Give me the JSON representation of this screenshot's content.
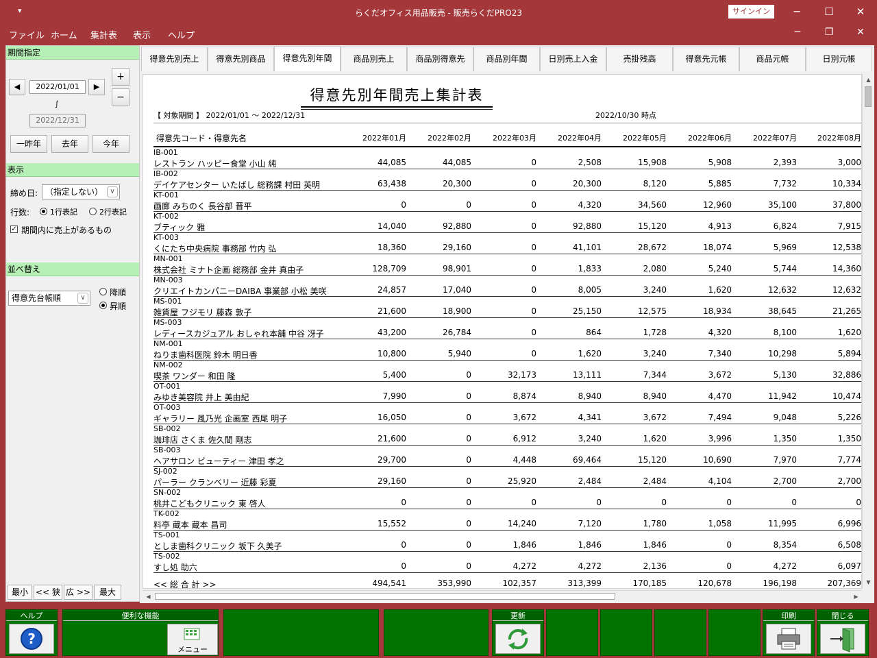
{
  "window": {
    "quick_access": "▾",
    "title": "らくだオフィス用品販売 - 販売らくだPRO23",
    "signin": "サインイン",
    "minimize": "─",
    "maximize": "☐",
    "close": "✕"
  },
  "menu": {
    "items": [
      "ファイル",
      "ホーム",
      "集計表",
      "表示",
      "ヘルプ"
    ],
    "mdi_minimize": "─",
    "mdi_restore": "❐",
    "mdi_close": "✕"
  },
  "left": {
    "period_header": "期間指定",
    "start_date": "2022/01/01",
    "tilde": "∫",
    "end_date": "2022/12/31",
    "prev": "◀",
    "next": "▶",
    "plus": "+",
    "minus": "−",
    "btn_year_before_last": "一昨年",
    "btn_last_year": "去年",
    "btn_this_year": "今年",
    "display_header": "表示",
    "cutoff_label": "締め日:",
    "cutoff_value": "（指定しない）",
    "rows_label": "行数:",
    "rows_opt1": "1行表記",
    "rows_opt2": "2行表記",
    "checkbox_label": "期間内に売上があるもの",
    "checkbox_mark": "✓",
    "sort_header": "並べ替え",
    "sort_value": "得意先台帳順",
    "sort_desc": "降順",
    "sort_asc": "昇順",
    "zoom": [
      "最小",
      "<< 狭",
      "広 >>",
      "最大"
    ]
  },
  "tabs": [
    "得意先別売上",
    "得意先別商品",
    "得意先別年間",
    "商品別売上",
    "商品別得意先",
    "商品別年間",
    "日別売上入金",
    "売掛残高",
    "得意先元帳",
    "商品元帳",
    "日別元帳"
  ],
  "report": {
    "title": "得意先別年間売上集計表",
    "period": "【 対象期間 】 2022/01/01 〜 2022/12/31",
    "as_of": "2022/10/30 時点",
    "col_name": "得意先コード・得意先名",
    "months": [
      "2022年01月",
      "2022年02月",
      "2022年03月",
      "2022年04月",
      "2022年05月",
      "2022年06月",
      "2022年07月",
      "2022年08月"
    ],
    "rows": [
      {
        "code": "IB-001",
        "name": "レストラン ハッピー食堂 小山 純",
        "v": [
          "44,085",
          "44,085",
          "0",
          "2,508",
          "15,908",
          "5,908",
          "2,393",
          "3,000"
        ]
      },
      {
        "code": "IB-002",
        "name": "デイケアセンター いたばし 総務課 村田 英明",
        "v": [
          "63,438",
          "20,300",
          "0",
          "20,300",
          "8,120",
          "5,885",
          "7,732",
          "10,334"
        ]
      },
      {
        "code": "KT-001",
        "name": "画廊 みちのく 長谷部 晋平",
        "v": [
          "0",
          "0",
          "0",
          "4,320",
          "34,560",
          "12,960",
          "35,100",
          "37,800"
        ]
      },
      {
        "code": "KT-002",
        "name": "ブティック 雅",
        "v": [
          "14,040",
          "92,880",
          "0",
          "92,880",
          "15,120",
          "4,913",
          "6,824",
          "7,915"
        ]
      },
      {
        "code": "KT-003",
        "name": "くにたち中央病院 事務部 竹内 弘",
        "v": [
          "18,360",
          "29,160",
          "0",
          "41,101",
          "28,672",
          "18,074",
          "5,969",
          "12,538"
        ]
      },
      {
        "code": "MN-001",
        "name": "株式会社 ミナト企画 総務部 金井 真由子",
        "v": [
          "128,709",
          "98,901",
          "0",
          "1,833",
          "2,080",
          "5,240",
          "5,744",
          "14,360"
        ]
      },
      {
        "code": "MN-003",
        "name": "クリエイトカンパニーDAIBA 事業部 小松 美咲",
        "v": [
          "24,857",
          "17,040",
          "0",
          "8,005",
          "3,240",
          "1,620",
          "12,632",
          "12,632"
        ]
      },
      {
        "code": "MS-001",
        "name": "雑貨屋 フジモリ 藤森 敦子",
        "v": [
          "21,600",
          "18,900",
          "0",
          "25,150",
          "12,575",
          "18,934",
          "38,645",
          "21,265"
        ]
      },
      {
        "code": "MS-003",
        "name": "レディースカジュアル おしゃれ本舗 中谷 冴子",
        "v": [
          "43,200",
          "26,784",
          "0",
          "864",
          "1,728",
          "4,320",
          "8,100",
          "1,620"
        ]
      },
      {
        "code": "NM-001",
        "name": "ねりま歯科医院 鈴木 明日香",
        "v": [
          "10,800",
          "5,940",
          "0",
          "1,620",
          "3,240",
          "7,340",
          "10,298",
          "5,894"
        ]
      },
      {
        "code": "NM-002",
        "name": "喫茶 ワンダー 和田 隆",
        "v": [
          "5,400",
          "0",
          "32,173",
          "13,111",
          "7,344",
          "3,672",
          "5,130",
          "32,886"
        ]
      },
      {
        "code": "OT-001",
        "name": "みゆき美容院 井上 美由紀",
        "v": [
          "7,990",
          "0",
          "8,874",
          "8,940",
          "8,940",
          "4,470",
          "11,942",
          "10,474"
        ]
      },
      {
        "code": "OT-003",
        "name": "ギャラリー 風乃光 企画室 西尾 明子",
        "v": [
          "16,050",
          "0",
          "3,672",
          "4,341",
          "3,672",
          "7,494",
          "9,048",
          "5,226"
        ]
      },
      {
        "code": "SB-002",
        "name": "珈琲店 さくま 佐久間 剛志",
        "v": [
          "21,600",
          "0",
          "6,912",
          "3,240",
          "1,620",
          "3,996",
          "1,350",
          "1,350"
        ]
      },
      {
        "code": "SB-003",
        "name": "ヘアサロン ビューティー 津田 孝之",
        "v": [
          "29,700",
          "0",
          "4,448",
          "69,464",
          "15,120",
          "10,690",
          "7,970",
          "7,774"
        ]
      },
      {
        "code": "SJ-002",
        "name": "パーラー クランベリー 近藤 彩夏",
        "v": [
          "29,160",
          "0",
          "25,920",
          "2,484",
          "2,484",
          "4,104",
          "2,700",
          "2,700"
        ]
      },
      {
        "code": "SN-002",
        "name": "桃井こどもクリニック 東 啓人",
        "v": [
          "0",
          "0",
          "0",
          "0",
          "0",
          "0",
          "0",
          "0"
        ]
      },
      {
        "code": "TK-002",
        "name": "料亭 蔵本 蔵本 昌司",
        "v": [
          "15,552",
          "0",
          "14,240",
          "7,120",
          "1,780",
          "1,058",
          "11,995",
          "6,996"
        ]
      },
      {
        "code": "TS-001",
        "name": "としま歯科クリニック 坂下 久美子",
        "v": [
          "0",
          "0",
          "1,846",
          "1,846",
          "1,846",
          "0",
          "8,354",
          "6,508"
        ]
      },
      {
        "code": "TS-002",
        "name": "すし処 助六",
        "v": [
          "0",
          "0",
          "4,272",
          "4,272",
          "2,136",
          "0",
          "4,272",
          "6,097"
        ]
      }
    ],
    "total_label": "<< 総 合 計 >>",
    "totals": [
      "494,541",
      "353,990",
      "102,357",
      "313,399",
      "170,185",
      "120,678",
      "196,198",
      "207,369"
    ]
  },
  "bottom": {
    "help": "ヘルプ",
    "useful": "便利な機能",
    "menu": "メニュー",
    "refresh": "更新",
    "print": "印刷",
    "close": "閉じる"
  }
}
